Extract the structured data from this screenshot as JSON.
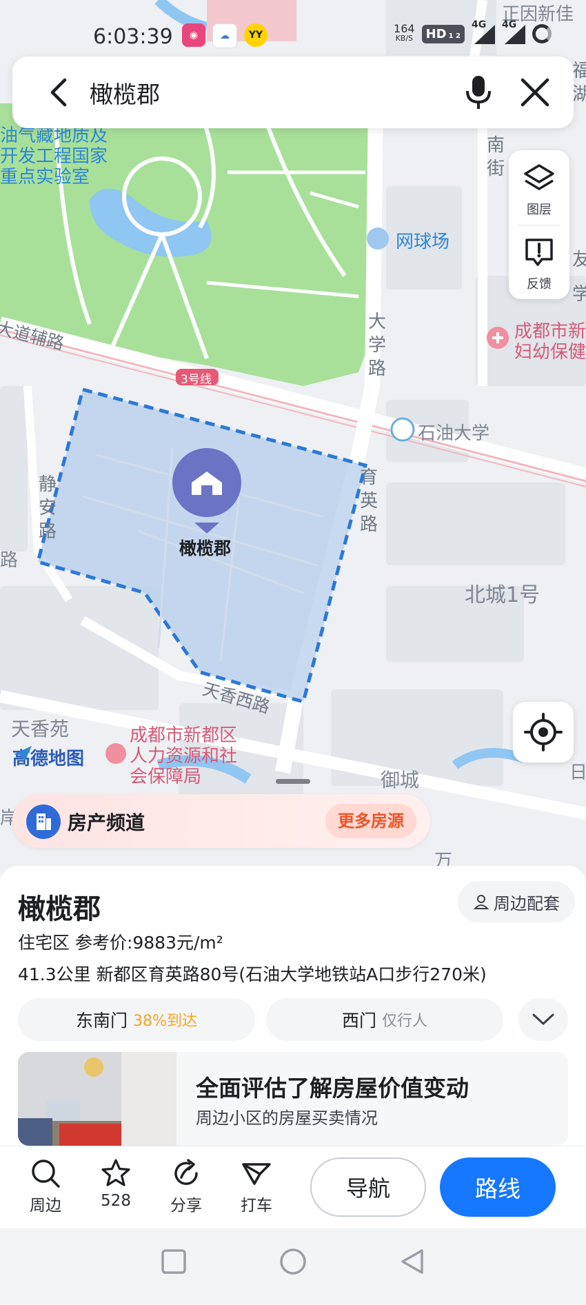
{
  "status_bar": {
    "time": "6:03:39",
    "net_speed_value": "164",
    "net_speed_unit": "KB/S",
    "hd_label": "HD",
    "hd_sub": "1 2",
    "signal_1_label": "4G",
    "signal_2_label": "4G",
    "app_yy_label": "YY"
  },
  "search": {
    "query": "橄榄郡"
  },
  "map_tools": {
    "layers_label": "图层",
    "feedback_label": "反馈"
  },
  "map": {
    "poi_selected": "橄榄郡",
    "labels": {
      "lab": "油气藏地质及 开发工程国家 重点实验室",
      "tennis": "网球场",
      "hospital": "成都市新 妇幼保健",
      "metro_line": "3号线",
      "metro_station": "石油大学",
      "road_daxue": "大学路",
      "road_fulu": "大道辅路",
      "road_jingan": "静安路",
      "road_yuying": "育英路",
      "road_tianxiang": "天香西路",
      "road_nanjie": "南街",
      "beicheng": "北城1号",
      "tianxiangyuan": "天香苑",
      "hr_bureau": "成都市新都区 人力资源和社 会保障局",
      "yucheng": "御城",
      "top_right": "正因新佳",
      "edge_fu": "福",
      "edge_hu": "湖",
      "edge_you": "友",
      "edge_xue": "学",
      "edge_an": "岸",
      "edge_ri": "日",
      "edge_wan": "万",
      "edge_lu": "路"
    },
    "logo_text": "高德地图"
  },
  "banner": {
    "title": "房产频道",
    "more": "更多房源"
  },
  "place": {
    "name": "橄榄郡",
    "nearby_button": "周边配套",
    "meta": "住宅区  参考价:9883元/m²",
    "address": "41.3公里  新都区育英路80号(石油大学地铁站A口步行270米)",
    "gates": [
      {
        "name": "东南门",
        "note": "38%到达"
      },
      {
        "name": "西门",
        "note": "仅行人"
      }
    ],
    "promo_title": "全面评估了解房屋价值变动",
    "promo_sub": "周边小区的房屋买卖情况"
  },
  "actions": {
    "nearby": "周边",
    "favorites": "528",
    "share": "分享",
    "taxi": "打车",
    "navigate": "导航",
    "route": "路线"
  },
  "colors": {
    "accent": "#1677ff",
    "boundary": "#2b78d6",
    "park": "#a8e09a",
    "pin": "#6a73c4"
  }
}
